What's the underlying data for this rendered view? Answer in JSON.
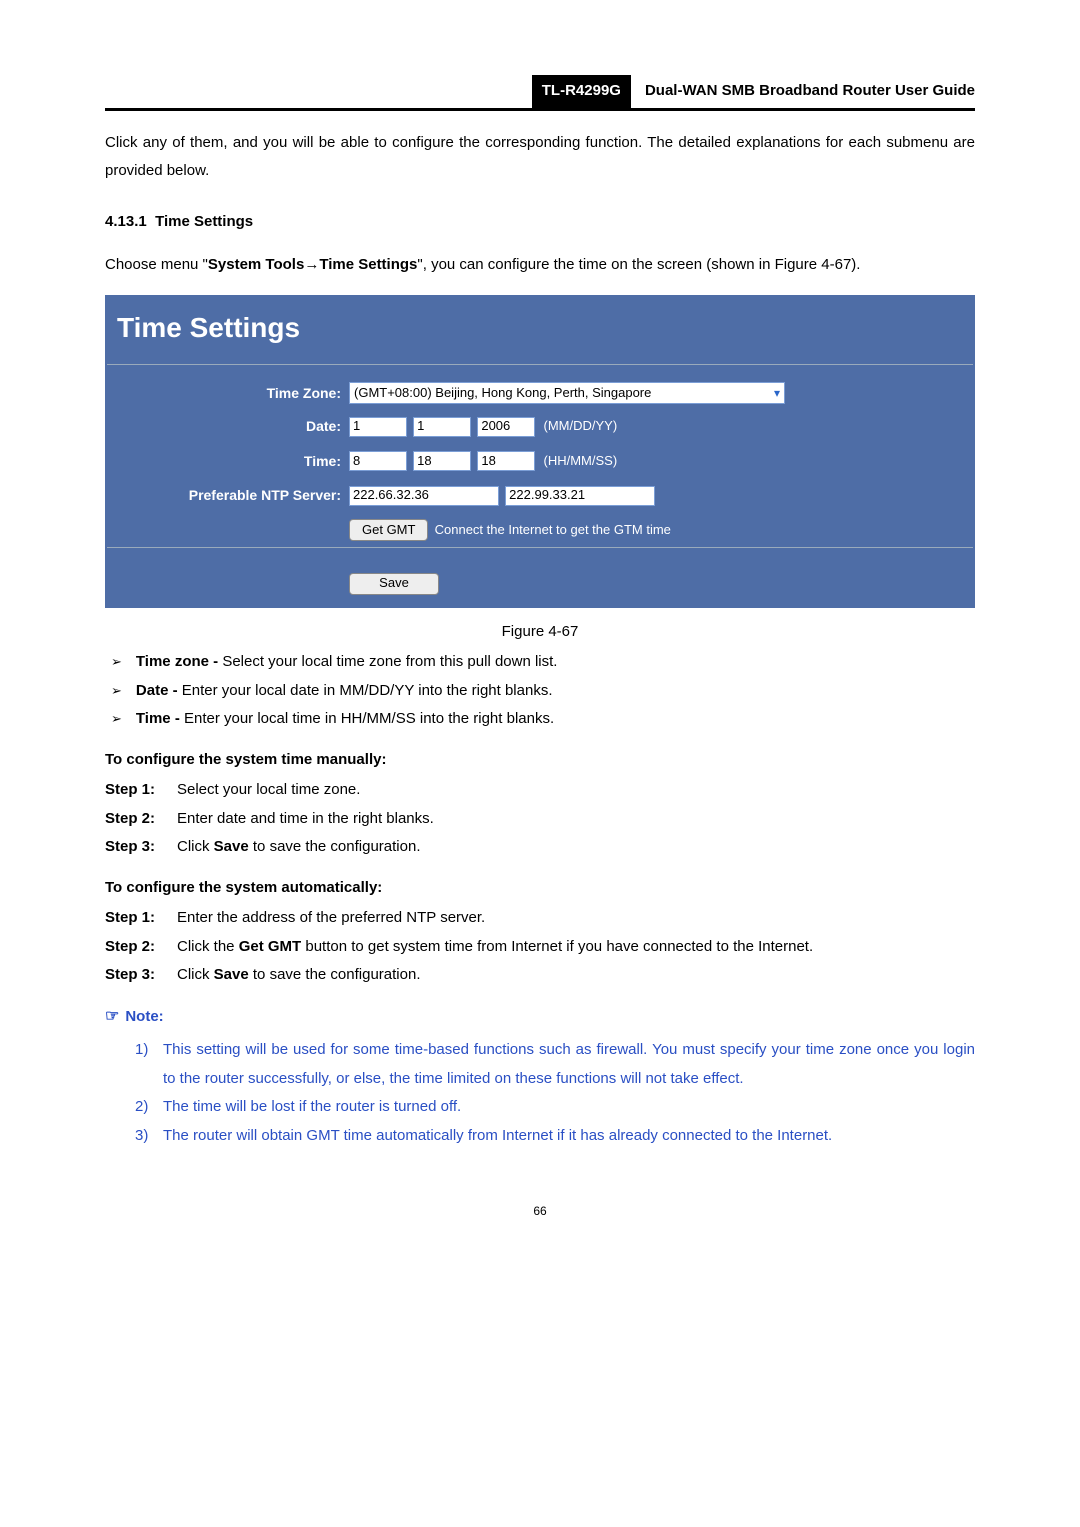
{
  "header": {
    "model": "TL-R4299G",
    "title": "Dual-WAN SMB Broadband Router User Guide"
  },
  "intro": "Click any of them, and you will be able to configure the corresponding function. The detailed explanations for each submenu are provided below.",
  "section": {
    "number": "4.13.1",
    "title": "Time Settings"
  },
  "choose_menu_prefix": "Choose menu \"",
  "menu_path_a": "System Tools",
  "arrow": "→",
  "menu_path_b": "Time Settings",
  "choose_menu_suffix": "\", you can configure the time on the screen (shown in Figure 4-67).",
  "panel": {
    "title": "Time Settings",
    "labels": {
      "timezone": "Time Zone:",
      "date": "Date:",
      "time": "Time:",
      "ntp": "Preferable NTP Server:"
    },
    "timezone_value": "(GMT+08:00) Beijing, Hong Kong, Perth, Singapore",
    "date": {
      "m": "1",
      "d": "1",
      "y": "2006",
      "hint": "(MM/DD/YY)"
    },
    "time": {
      "h": "8",
      "m": "18",
      "s": "18",
      "hint": "(HH/MM/SS)"
    },
    "ntp": {
      "a": "222.66.32.36",
      "b": "222.99.33.21"
    },
    "get_gmt_btn": "Get GMT",
    "get_gmt_note": "Connect the Internet to get the GTM time",
    "save_btn": "Save"
  },
  "fig_caption": "Figure 4-67",
  "bullets": [
    {
      "bold": "Time zone -",
      "text": " Select your local time zone from this pull down list."
    },
    {
      "bold": "Date -",
      "text": " Enter your local date in MM/DD/YY into the right blanks."
    },
    {
      "bold": "Time -",
      "text": " Enter your local time in HH/MM/SS into the right blanks."
    }
  ],
  "manual_heading": "To configure the system time manually:",
  "manual_steps": [
    {
      "label": "Step 1:",
      "pre": "Select your local time zone."
    },
    {
      "label": "Step 2:",
      "pre": "Enter date and time in the right blanks."
    },
    {
      "label": "Step 3:",
      "pre": "Click ",
      "bold": "Save",
      "post": " to save the configuration."
    }
  ],
  "auto_heading": "To configure the system automatically:",
  "auto_steps": [
    {
      "label": "Step 1:",
      "pre": "Enter the address of the preferred NTP server."
    },
    {
      "label": "Step 2:",
      "pre": "Click the ",
      "bold": "Get GMT",
      "post": " button to get system time from Internet if you have connected to the Internet."
    },
    {
      "label": "Step 3:",
      "pre": "Click ",
      "bold": "Save",
      "post": " to save the configuration."
    }
  ],
  "note_label": "Note:",
  "notes": [
    "This setting will be used for some time-based functions such as firewall. You must specify your time zone once you login to the router successfully, or else, the time limited on these functions will not take effect.",
    "The time will be lost if the router is turned off.",
    "The router will obtain GMT time automatically from Internet if it has already connected to the Internet."
  ],
  "page_number": "66"
}
